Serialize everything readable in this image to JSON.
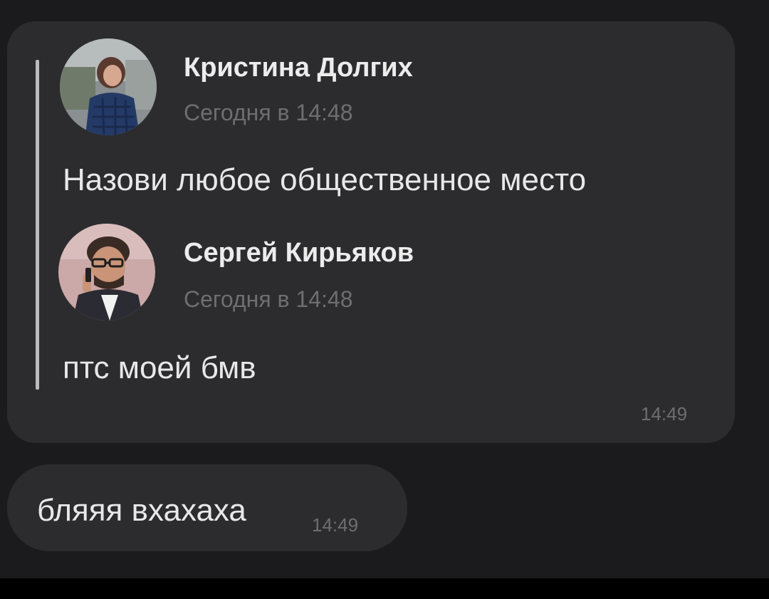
{
  "forwarded": {
    "messages": [
      {
        "author": "Кристина Долгих",
        "time": "Сегодня в 14:48",
        "text": "Назови любое общественное место",
        "avatar_icon": "user-avatar-icon"
      },
      {
        "author": "Сергей Кирьяков",
        "time": "Сегодня в 14:48",
        "text": "птс моей бмв",
        "avatar_icon": "user-avatar-icon"
      }
    ],
    "time": "14:49"
  },
  "reply": {
    "text": "бляяя вхахаха",
    "time": "14:49"
  },
  "colors": {
    "background": "#1b1b1d",
    "bubble": "#2c2c2e",
    "quote_bar": "#bcbcbc",
    "muted_text": "#6e6e72"
  }
}
